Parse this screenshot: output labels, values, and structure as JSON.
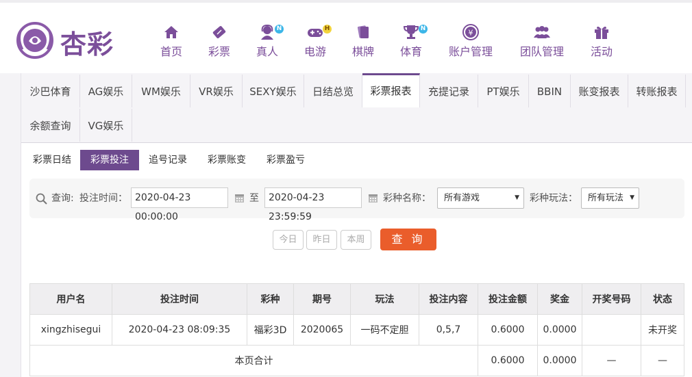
{
  "brand": {
    "name": "杏彩"
  },
  "nav": [
    {
      "label": "首页",
      "icon": "home-icon",
      "badge": ""
    },
    {
      "label": "彩票",
      "icon": "lottery-ticket-icon",
      "badge": ""
    },
    {
      "label": "真人",
      "icon": "live-dealer-icon",
      "badge": "N"
    },
    {
      "label": "电游",
      "icon": "gamepad-icon",
      "badge": "H"
    },
    {
      "label": "棋牌",
      "icon": "cards-icon",
      "badge": ""
    },
    {
      "label": "体育",
      "icon": "trophy-icon",
      "badge": "N"
    },
    {
      "label": "账户管理",
      "icon": "yen-coin-icon",
      "badge": ""
    },
    {
      "label": "团队管理",
      "icon": "team-icon",
      "badge": ""
    },
    {
      "label": "活动",
      "icon": "gift-icon",
      "badge": ""
    }
  ],
  "tabs": [
    "沙巴体育",
    "AG娱乐",
    "WM娱乐",
    "VR娱乐",
    "SEXY娱乐",
    "日结总览",
    "彩票报表",
    "充提记录",
    "PT娱乐",
    "BBIN",
    "账变报表",
    "转账报表",
    "余额查询",
    "VG娱乐"
  ],
  "active_tab": "彩票报表",
  "subtabs": [
    "彩票日结",
    "彩票投注",
    "追号记录",
    "彩票账变",
    "彩票盈亏"
  ],
  "active_subtab": "彩票投注",
  "query": {
    "label": "查询:",
    "time_label": "投注时间：",
    "start": "2020-04-23 00:00:00",
    "to": "至",
    "end": "2020-04-23 23:59:59",
    "game_label": "彩种名称：",
    "game_value": "所有游戏",
    "play_label": "彩种玩法：",
    "play_value": "所有玩法"
  },
  "quick_buttons": [
    "今日",
    "昨日",
    "本周"
  ],
  "query_button": "查 询",
  "table": {
    "headers": [
      "用户名",
      "投注时间",
      "彩种",
      "期号",
      "玩法",
      "投注内容",
      "投注金额",
      "奖金",
      "开奖号码",
      "状态"
    ],
    "rows": [
      [
        "xingzhisegui",
        "2020-04-23 08:09:35",
        "福彩3D",
        "2020065",
        "一码不定胆",
        "0,5,7",
        "0.6000",
        "0.0000",
        "",
        "未开奖"
      ]
    ],
    "total": {
      "label": "本页合计",
      "amount": "0.6000",
      "bonus": "0.0000",
      "numbers": "—",
      "status": "—"
    }
  },
  "colors": {
    "brand": "#7b4e9a",
    "active": "#6d4a8e",
    "query_button": "#ea5d2b",
    "status_pending": "#3c8c1c"
  }
}
